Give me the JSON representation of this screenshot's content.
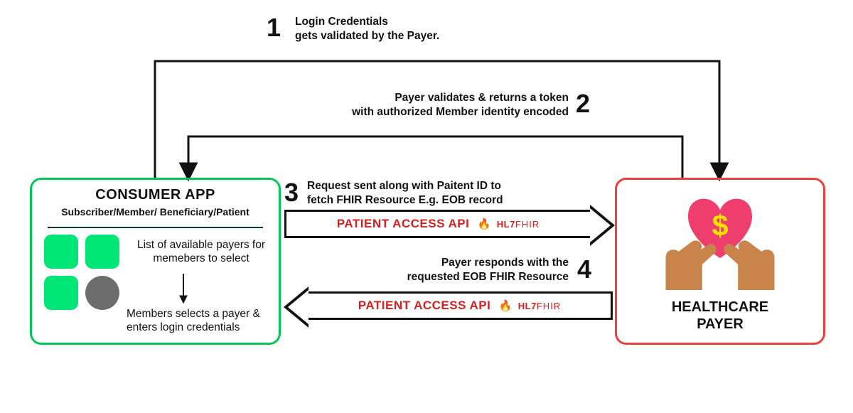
{
  "consumer": {
    "title": "CONSUMER APP",
    "subtitle": "Subscriber/Member/ Beneficiary/Patient",
    "list_text": "List of available payers for memebers to select",
    "select_text": "Members selects a payer & enters login credentials"
  },
  "payer": {
    "title_line1": "HEALTHCARE",
    "title_line2": "PAYER"
  },
  "steps": {
    "s1_num": "1",
    "s1_text": "Login Credentials\ngets validated by the Payer.",
    "s2_num": "2",
    "s2_text": "Payer validates & returns a token\nwith authorized Member identity encoded",
    "s3_num": "3",
    "s3_text": "Request sent along with Paitent ID to\nfetch FHIR Resource E.g. EOB record",
    "s4_num": "4",
    "s4_text": "Payer responds with the\nrequested EOB FHIR Resource"
  },
  "api": {
    "label": "PATIENT ACCESS API",
    "hl7": "HL7",
    "fhir": "FHIR"
  }
}
